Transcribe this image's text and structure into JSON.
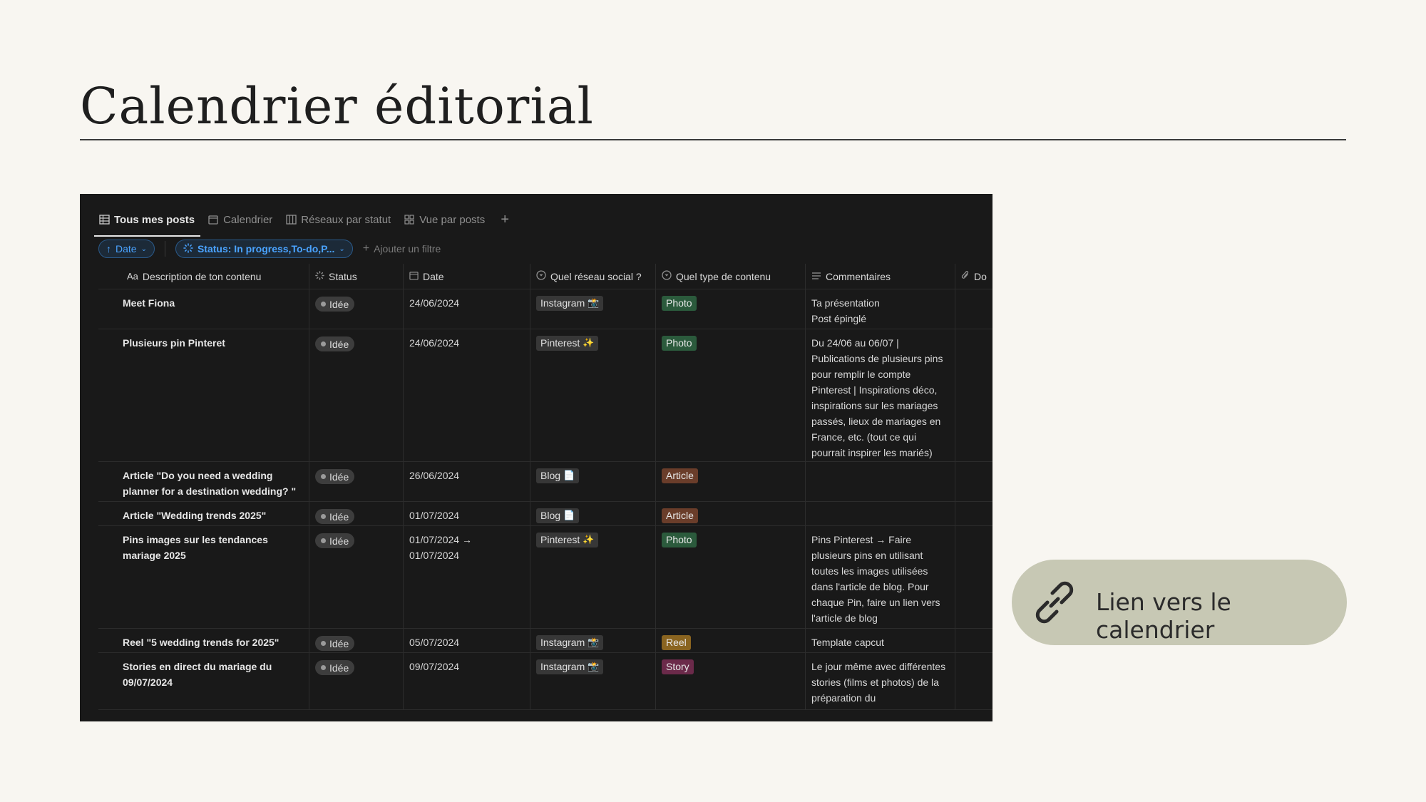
{
  "page": {
    "title": "Calendrier éditorial",
    "link_button_label": "Lien vers le calendrier"
  },
  "tabs": [
    {
      "label": "Tous mes posts",
      "icon": "table-icon",
      "active": true
    },
    {
      "label": "Calendrier",
      "icon": "calendar-icon",
      "active": false
    },
    {
      "label": "Réseaux par statut",
      "icon": "board-icon",
      "active": false
    },
    {
      "label": "Vue par posts",
      "icon": "gallery-icon",
      "active": false
    }
  ],
  "tab_add": "+",
  "filters": {
    "sort_chip": "Date",
    "status_chip": "Status: In progress,To-do,P...",
    "add_filter": "Ajouter un filtre"
  },
  "columns": {
    "description": "Description de ton contenu",
    "description_icon": "Aa",
    "status": "Status",
    "date": "Date",
    "network": "Quel réseau social ?",
    "type": "Quel type de contenu",
    "comments": "Commentaires",
    "files": "Do"
  },
  "rows": [
    {
      "title": "Meet Fiona",
      "status": "Idée",
      "date": "24/06/2024",
      "network": "Instagram",
      "network_emoji": "📸",
      "type": "Photo",
      "type_class": "photo",
      "comment": "Ta présentation\nPost épinglé"
    },
    {
      "title": "Plusieurs pin Pinteret",
      "status": "Idée",
      "date": "24/06/2024",
      "network": "Pinterest",
      "network_emoji": "✨",
      "type": "Photo",
      "type_class": "photo",
      "comment": "Du 24/06 au 06/07 | Publications de plusieurs pins pour remplir le compte Pinterest | Inspirations déco, inspirations sur les mariages passés, lieux de mariages en France, etc. (tout ce qui pourrait inspirer les mariés)"
    },
    {
      "title": "Article \"Do you need a wedding planner for a destination wedding? \"",
      "status": "Idée",
      "date": "26/06/2024",
      "network": "Blog",
      "network_emoji": "📄",
      "type": "Article",
      "type_class": "article",
      "comment": ""
    },
    {
      "title": "Article \"Wedding trends 2025\"",
      "status": "Idée",
      "date": "01/07/2024",
      "network": "Blog",
      "network_emoji": "📄",
      "type": "Article",
      "type_class": "article",
      "comment": ""
    },
    {
      "title": "Pins images sur les tendances mariage 2025",
      "status": "Idée",
      "date": "01/07/2024 → 01/07/2024",
      "network": "Pinterest",
      "network_emoji": "✨",
      "type": "Photo",
      "type_class": "photo",
      "comment": "Pins Pinterest → Faire plusieurs pins en utilisant toutes les images utilisées dans l'article de blog. Pour chaque Pin, faire un lien vers l'article de blog"
    },
    {
      "title": "Reel \"5 wedding trends for 2025\"",
      "status": "Idée",
      "date": "05/07/2024",
      "network": "Instagram",
      "network_emoji": "📸",
      "type": "Reel",
      "type_class": "reel",
      "comment": "Template capcut"
    },
    {
      "title": "Stories en direct du mariage du 09/07/2024",
      "status": "Idée",
      "date": "09/07/2024",
      "network": "Instagram",
      "network_emoji": "📸",
      "type": "Story",
      "type_class": "story",
      "comment": "Le jour même avec différentes stories (films et photos) de la préparation du"
    }
  ],
  "colors": {
    "page_bg": "#f8f6f1",
    "app_bg": "#191919",
    "link_button_bg": "#c7c8b4",
    "filter_accent": "#4aa3ff"
  }
}
